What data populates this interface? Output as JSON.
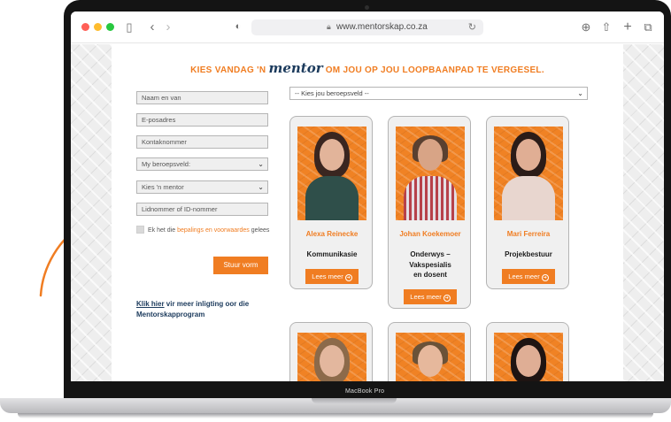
{
  "browser": {
    "url": "www.mentorskap.co.za"
  },
  "page": {
    "headline_before": "KIES VANDAG 'N ",
    "headline_script": "mentor",
    "headline_after": " OM JOU OP JOU LOOPBAANPAD TE VERGESEL.",
    "form": {
      "name_placeholder": "Naam en van",
      "email_placeholder": "E-posadres",
      "contact_placeholder": "Kontaknommer",
      "field_select": "My beroepsveld:",
      "mentor_select": "Kies 'n mentor",
      "member_placeholder": "Lidnommer of ID-nommer",
      "consent_before": "Ek het die ",
      "consent_link": "bepalings en voorwaardes",
      "consent_after": " gelees",
      "submit_label": "Stuur vorm"
    },
    "info_link": "Klik hier",
    "info_text": " vir meer inligting oor die Mentorskapprogram",
    "career_select": "-- Kies jou beroepsveld --",
    "mentors": [
      {
        "name": "Alexa Reinecke",
        "role_lines": [
          "Kommunikasie"
        ],
        "button": "Lees meer"
      },
      {
        "name": "Johan Koekemoer",
        "role_lines": [
          "Onderwys –",
          "Vakspesialis",
          "en dosent"
        ],
        "button": "Lees meer"
      },
      {
        "name": "Mari Ferreira",
        "role_lines": [
          "Projekbestuur"
        ],
        "button": "Lees meer"
      }
    ]
  },
  "device": {
    "model_label": "MacBook Pro"
  },
  "colors": {
    "accent": "#f07d22",
    "navy": "#1b3a5c"
  }
}
